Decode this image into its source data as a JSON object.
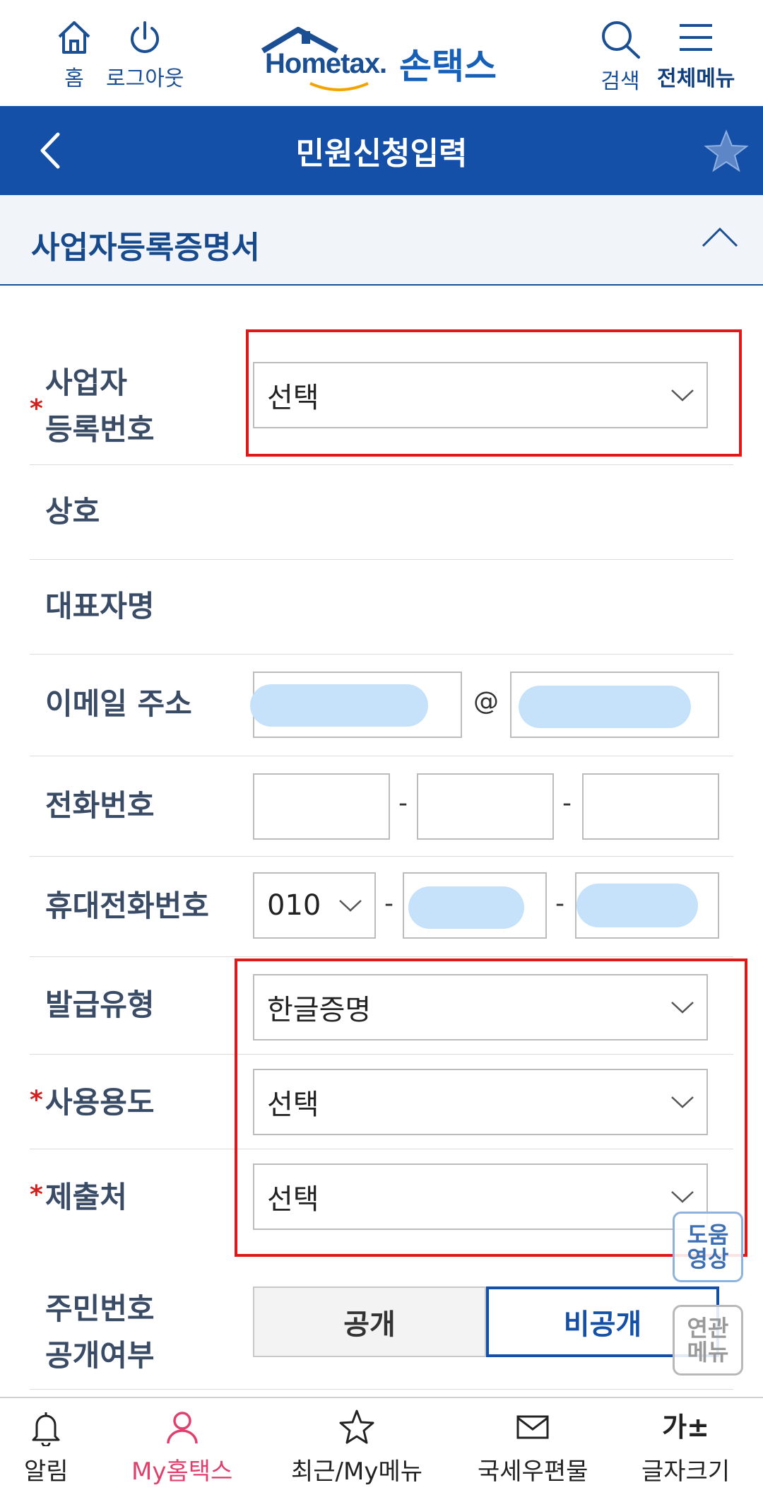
{
  "header": {
    "home_label": "홈",
    "logout_label": "로그아웃",
    "logo_text": "Hometax.",
    "logo_kr": "손택스",
    "search_label": "검색",
    "menu_label": "전체메뉴"
  },
  "titlebar": {
    "title": "민원신청입력"
  },
  "section": {
    "title": "사업자등록증명서"
  },
  "form": {
    "biz_number": {
      "label_line1": "사업자",
      "label_line2": "등록번호",
      "value": "선택",
      "required": "*"
    },
    "company_label": "상호",
    "ceo_label": "대표자명",
    "email": {
      "label": "이메일 주소",
      "at": "@"
    },
    "phone": {
      "label": "전화번호",
      "dash": "-"
    },
    "mobile": {
      "label": "휴대전화번호",
      "prefix": "010",
      "dash": "-"
    },
    "issue_type": {
      "label": "발급유형",
      "value": "한글증명"
    },
    "usage": {
      "label": "사용용도",
      "value": "선택",
      "required": "*"
    },
    "submit_to": {
      "label": "제출처",
      "value": "선택",
      "required": "*"
    },
    "rrn": {
      "label_line1": "주민번호",
      "label_line2": "공개여부",
      "public": "공개",
      "private": "비공개",
      "selected": "비공개"
    }
  },
  "floating": {
    "help_line1": "도움",
    "help_line2": "영상",
    "related_line1": "연관",
    "related_line2": "메뉴"
  },
  "bottomnav": {
    "items": [
      {
        "label": "알림",
        "icon": "bell-icon"
      },
      {
        "label": "My홈택스",
        "icon": "person-icon",
        "active": true
      },
      {
        "label": "최근/My메뉴",
        "icon": "star-icon"
      },
      {
        "label": "국세우편물",
        "icon": "mail-icon"
      },
      {
        "label": "글자크기",
        "icon": "text-size-icon",
        "glyph": "가±"
      }
    ]
  },
  "colors": {
    "brand": "#1450a8",
    "highlight_red": "#e01818",
    "active_pink": "#e0406e",
    "blurred": "#c6e2fb"
  }
}
